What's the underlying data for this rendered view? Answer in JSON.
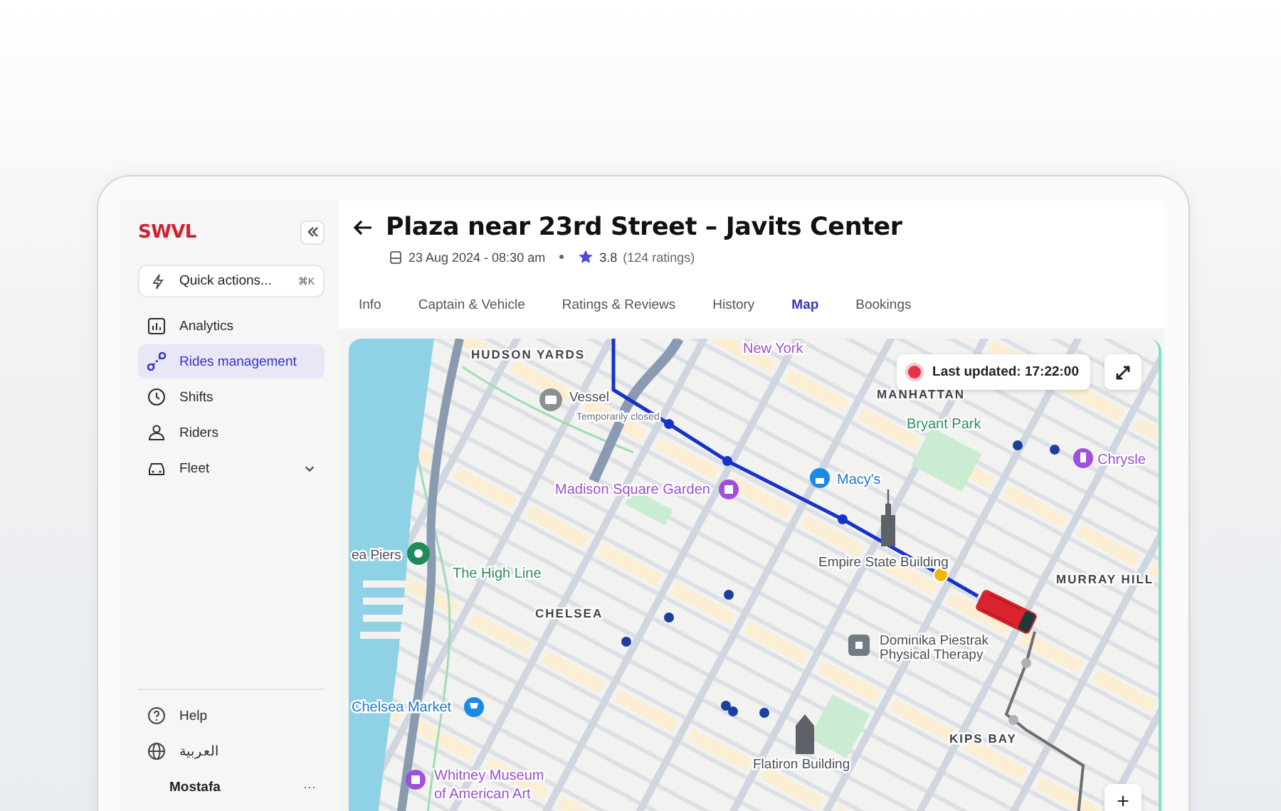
{
  "sidebar": {
    "logo": "SWVL",
    "quick_actions": {
      "label": "Quick actions...",
      "shortcut": "⌘K"
    },
    "items": [
      {
        "label": "Analytics",
        "selected": false,
        "expandable": false
      },
      {
        "label": "Rides management",
        "selected": true,
        "expandable": false
      },
      {
        "label": "Shifts",
        "selected": false,
        "expandable": false
      },
      {
        "label": "Riders",
        "selected": false,
        "expandable": false
      },
      {
        "label": "Fleet",
        "selected": false,
        "expandable": true
      }
    ],
    "footer": [
      {
        "label": "Help",
        "kind": "help"
      },
      {
        "label": "العربية",
        "kind": "language"
      }
    ],
    "user": {
      "name": "Mostafa",
      "menu": "···"
    }
  },
  "ride": {
    "title": "Plaza near 23rd Street – Javits Center",
    "date": "23 Aug 2024 - 08:30 am",
    "rating": "3.8",
    "ratings_count": "(124 ratings)"
  },
  "tabs": [
    {
      "label": "Info",
      "selected": false
    },
    {
      "label": "Captain & Vehicle",
      "selected": false
    },
    {
      "label": "Ratings & Reviews",
      "selected": false
    },
    {
      "label": "History",
      "selected": false
    },
    {
      "label": "Map",
      "selected": true
    },
    {
      "label": "Bookings",
      "selected": false
    }
  ],
  "map": {
    "status": "Last updated: 17:22:00",
    "zoom_in": "+",
    "labels": [
      {
        "text": "New York",
        "kind": "culture"
      },
      {
        "text": "HUDSON YARDS",
        "kind": "district"
      },
      {
        "text": "Vessel",
        "kind": "place"
      },
      {
        "text": "Temporarily closed",
        "kind": "note"
      },
      {
        "text": "Madison Square Garden",
        "kind": "culture"
      },
      {
        "text": "ea Piers",
        "kind": "place"
      },
      {
        "text": "The High Line",
        "kind": "park"
      },
      {
        "text": "CHELSEA",
        "kind": "district"
      },
      {
        "text": "Chelsea Market",
        "kind": "shop"
      },
      {
        "text": "Whitney Museum",
        "kind": "culture"
      },
      {
        "text": "of American Art",
        "kind": "culture"
      },
      {
        "text": "Flatiron Building",
        "kind": "place"
      },
      {
        "text": "MANHATTAN",
        "kind": "district"
      },
      {
        "text": "Bryant Park",
        "kind": "park"
      },
      {
        "text": "Macy's",
        "kind": "shop"
      },
      {
        "text": "Chrysle",
        "kind": "culture"
      },
      {
        "text": "Empire State Building",
        "kind": "place"
      },
      {
        "text": "MURRAY HILL",
        "kind": "district"
      },
      {
        "text": "Dominika Piestrak",
        "kind": "place"
      },
      {
        "text": "Physical Therapy",
        "kind": "place"
      },
      {
        "text": "KIPS BAY",
        "kind": "district"
      }
    ]
  }
}
